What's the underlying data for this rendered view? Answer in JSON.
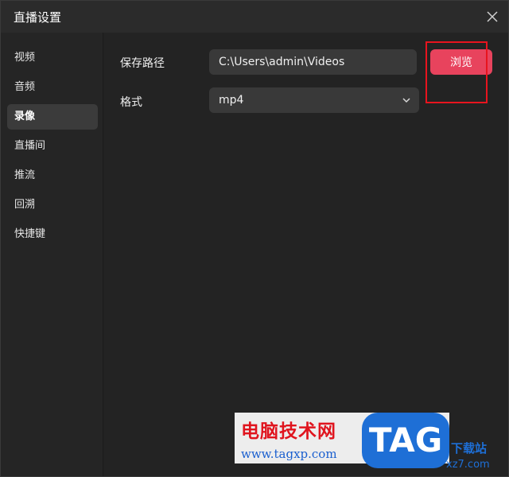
{
  "window": {
    "title": "直播设置"
  },
  "sidebar": {
    "items": [
      {
        "label": "视频"
      },
      {
        "label": "音频"
      },
      {
        "label": "录像"
      },
      {
        "label": "直播间"
      },
      {
        "label": "推流"
      },
      {
        "label": "回溯"
      },
      {
        "label": "快捷键"
      }
    ],
    "active_index": 2
  },
  "recording": {
    "save_path_label": "保存路径",
    "save_path_value": "C:\\Users\\admin\\Videos",
    "browse_label": "浏览",
    "format_label": "格式",
    "format_value": "mp4"
  },
  "watermark": {
    "brand_cn": "电脑技术网",
    "url": "www.tagxp.com",
    "logo": "TAG",
    "site_cn": "下载站",
    "site_url": "xz7.com"
  },
  "colors": {
    "accent": "#e8435d",
    "highlight_box": "#e8141e",
    "background": "#232323"
  },
  "icons": {
    "close": "close-icon",
    "dropdown": "chevron-down-icon"
  }
}
